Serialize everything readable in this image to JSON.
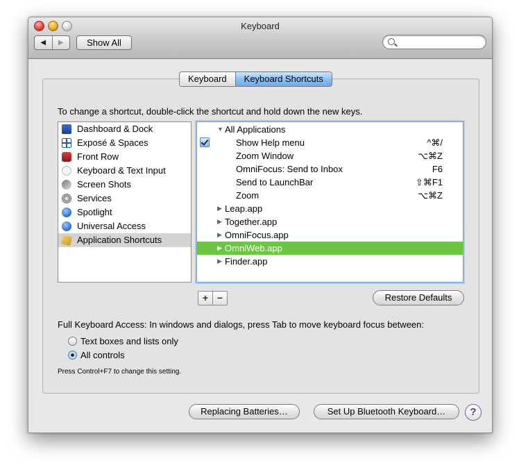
{
  "window": {
    "title": "Keyboard",
    "nav_back_icon": "◀",
    "nav_forward_icon": "▶",
    "show_all_label": "Show All",
    "search": {
      "value": "",
      "placeholder": ""
    }
  },
  "tabs": [
    {
      "label": "Keyboard",
      "selected": false
    },
    {
      "label": "Keyboard Shortcuts",
      "selected": true
    }
  ],
  "instruction": "To change a shortcut, double-click the shortcut and hold down the new keys.",
  "categories": [
    {
      "label": "Dashboard & Dock",
      "icon": "dashboard-icon"
    },
    {
      "label": "Exposé & Spaces",
      "icon": "expose-icon"
    },
    {
      "label": "Front Row",
      "icon": "front-row-icon"
    },
    {
      "label": "Keyboard & Text Input",
      "icon": "keyboard-icon"
    },
    {
      "label": "Screen Shots",
      "icon": "screenshot-icon"
    },
    {
      "label": "Services",
      "icon": "gear-icon"
    },
    {
      "label": "Spotlight",
      "icon": "spotlight-icon"
    },
    {
      "label": "Universal Access",
      "icon": "universal-access-icon"
    },
    {
      "label": "Application Shortcuts",
      "icon": "app-shortcuts-icon",
      "selected": true
    }
  ],
  "shortcuts": [
    {
      "label": "All Applications",
      "disclosure": "▼",
      "key": ""
    },
    {
      "label": "Show Help menu",
      "checked": true,
      "key": "^⌘/"
    },
    {
      "label": "Zoom Window",
      "key": "⌥⌘Z"
    },
    {
      "label": "OmniFocus: Send to Inbox",
      "key": "F6"
    },
    {
      "label": "Send to LaunchBar",
      "key": "⇧⌘F1"
    },
    {
      "label": "Zoom",
      "key": "⌥⌘Z"
    },
    {
      "label": "Leap.app",
      "disclosure": "▶",
      "key": ""
    },
    {
      "label": "Together.app",
      "disclosure": "▶",
      "key": ""
    },
    {
      "label": "OmniFocus.app",
      "disclosure": "▶",
      "key": ""
    },
    {
      "label": "OmniWeb.app",
      "disclosure": "▶",
      "key": "",
      "selected": true
    },
    {
      "label": "Finder.app",
      "disclosure": "▶",
      "key": ""
    }
  ],
  "add_label": "+",
  "remove_label": "−",
  "restore_defaults_label": "Restore Defaults",
  "full_keyboard_access": {
    "text": "Full Keyboard Access: In windows and dialogs, press Tab to move keyboard focus between:",
    "options": [
      {
        "label": "Text boxes and lists only",
        "selected": false
      },
      {
        "label": "All controls",
        "selected": true
      }
    ],
    "note": "Press Control+F7 to change this setting."
  },
  "footer": {
    "replacing_batteries_label": "Replacing Batteries…",
    "setup_bluetooth_label": "Set Up Bluetooth Keyboard…",
    "help_label": "?"
  },
  "colors": {
    "selection_green": "#6cc644",
    "selected_tab_blue": "#8ec0ef"
  }
}
